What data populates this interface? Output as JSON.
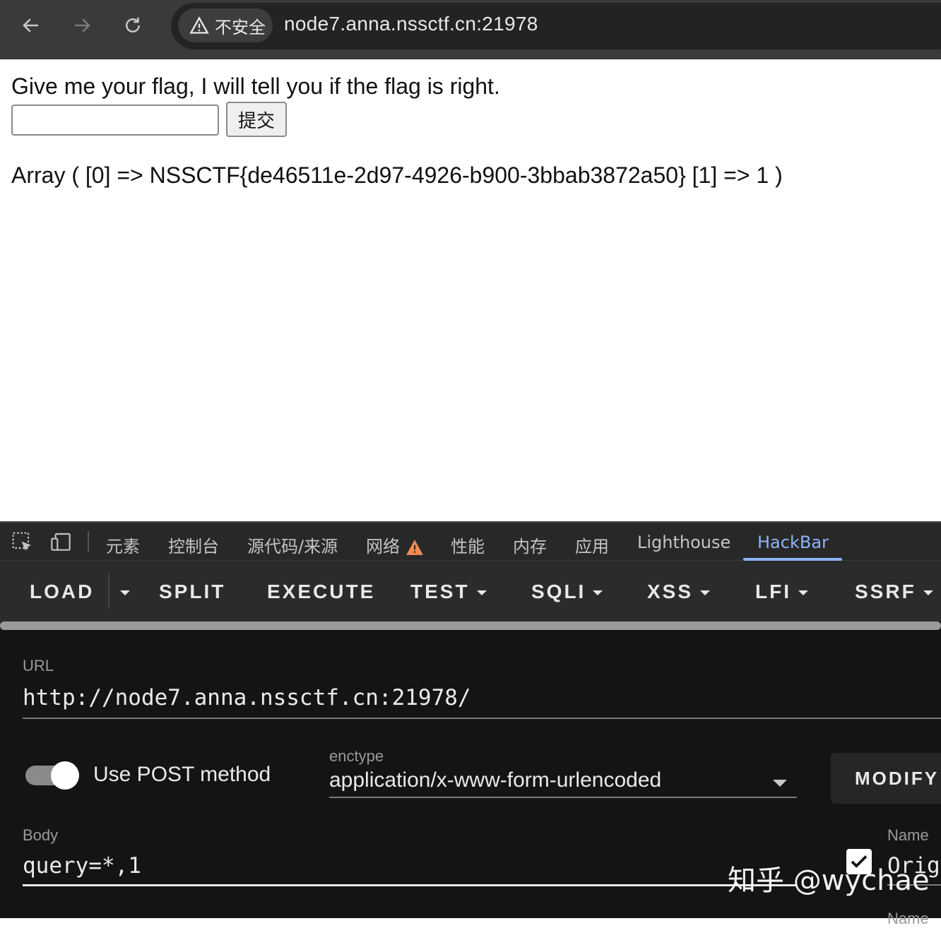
{
  "browser": {
    "security_label": "不安全",
    "address": "node7.anna.nssctf.cn:21978"
  },
  "page": {
    "prompt": "Give me your flag, I will tell you if the flag is right.",
    "input_value": "",
    "submit_label": "提交",
    "result": "Array ( [0] => NSSCTF{de46511e-2d97-4926-b900-3bbab3872a50} [1] => 1 )"
  },
  "devtools": {
    "tabs": [
      "元素",
      "控制台",
      "源代码/来源",
      "网络",
      "性能",
      "内存",
      "应用",
      "Lighthouse",
      "HackBar"
    ],
    "active_tab": "HackBar",
    "warning_color": "#f28b54",
    "accent_color": "#8ab4f8"
  },
  "hackbar": {
    "toolbar": [
      "LOAD",
      "SPLIT",
      "EXECUTE",
      "TEST",
      "SQLI",
      "XSS",
      "LFI",
      "SSRF"
    ],
    "url_label": "URL",
    "url_value": "http://node7.anna.nssctf.cn:21978/",
    "post_toggle_label": "Use POST method",
    "post_enabled": true,
    "enctype_label": "enctype",
    "enctype_value": "application/x-www-form-urlencoded",
    "modify_label": "MODIFY",
    "body_label": "Body",
    "body_value": "query=*,1",
    "name_label": "Name",
    "name_value_partial": "Orig",
    "header_checked": true
  },
  "watermark": "知乎 @wychae"
}
